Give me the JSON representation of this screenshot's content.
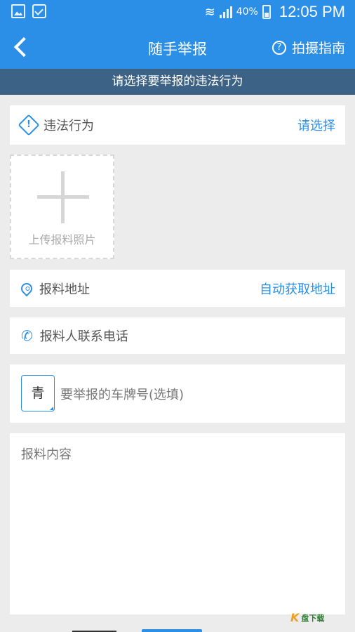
{
  "status_bar": {
    "battery": "40%",
    "time": "12:05 PM"
  },
  "header": {
    "title": "随手举报",
    "guide_label": "拍摄指南"
  },
  "banner": {
    "text": "请选择要举报的违法行为"
  },
  "violation_row": {
    "label": "违法行为",
    "action": "请选择"
  },
  "upload": {
    "label": "上传报料照片"
  },
  "address_row": {
    "label": "报料地址",
    "action": "自动获取地址"
  },
  "phone_row": {
    "placeholder": "报料人联系电话"
  },
  "plate_row": {
    "province": "青",
    "placeholder": "要举报的车牌号(选填)"
  },
  "content_row": {
    "placeholder": "报料内容"
  },
  "watermark": {
    "logo_text": "盘下载"
  },
  "colors": {
    "primary": "#2b8fe8",
    "banner": "#3c6286",
    "background": "#ececec"
  }
}
